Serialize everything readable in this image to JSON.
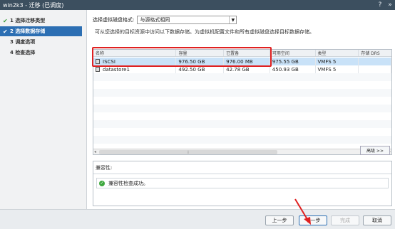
{
  "window": {
    "title": "win2k3 - 迁移 (已调度)",
    "help_icon": "?",
    "expand_icon": "»"
  },
  "sidebar": {
    "steps": [
      {
        "number": "1",
        "label": "选择迁移类型",
        "done": true
      },
      {
        "number": "2",
        "label": "选择数据存储",
        "done": true,
        "active": true
      },
      {
        "number": "3",
        "label": "调度选项",
        "done": false
      },
      {
        "number": "4",
        "label": "检查选择",
        "done": false
      }
    ]
  },
  "main": {
    "disk_format_label": "选择虚拟磁盘格式:",
    "disk_format_value": "与源格式相同",
    "description": "可从您选择的目标资源中访问以下数据存储。为虚拟机配置文件和所有虚拟磁盘选择目标数据存储。",
    "table": {
      "columns": [
        "名称",
        "容量",
        "已置备",
        "可用空间",
        "类型",
        "存储 DRS"
      ],
      "rows": [
        {
          "name": "ISCSI",
          "capacity": "976.50 GB",
          "provisioned": "976.00 MB",
          "free": "975.55 GB",
          "type": "VMFS 5",
          "drs": "",
          "selected": true
        },
        {
          "name": "datastore1",
          "capacity": "492.50 GB",
          "provisioned": "42.78 GB",
          "free": "450.93 GB",
          "type": "VMFS 5",
          "drs": "",
          "selected": false
        }
      ]
    },
    "advanced_button": "高级 >>",
    "compatibility": {
      "label": "兼容性:",
      "message": "兼容性检查成功。"
    }
  },
  "footer": {
    "back": "上一步",
    "next": "下一步",
    "finish": "完成",
    "cancel": "取消"
  },
  "colors": {
    "accent": "#2c6fb3",
    "highlight": "#e02020",
    "ok": "#3ea83e"
  }
}
